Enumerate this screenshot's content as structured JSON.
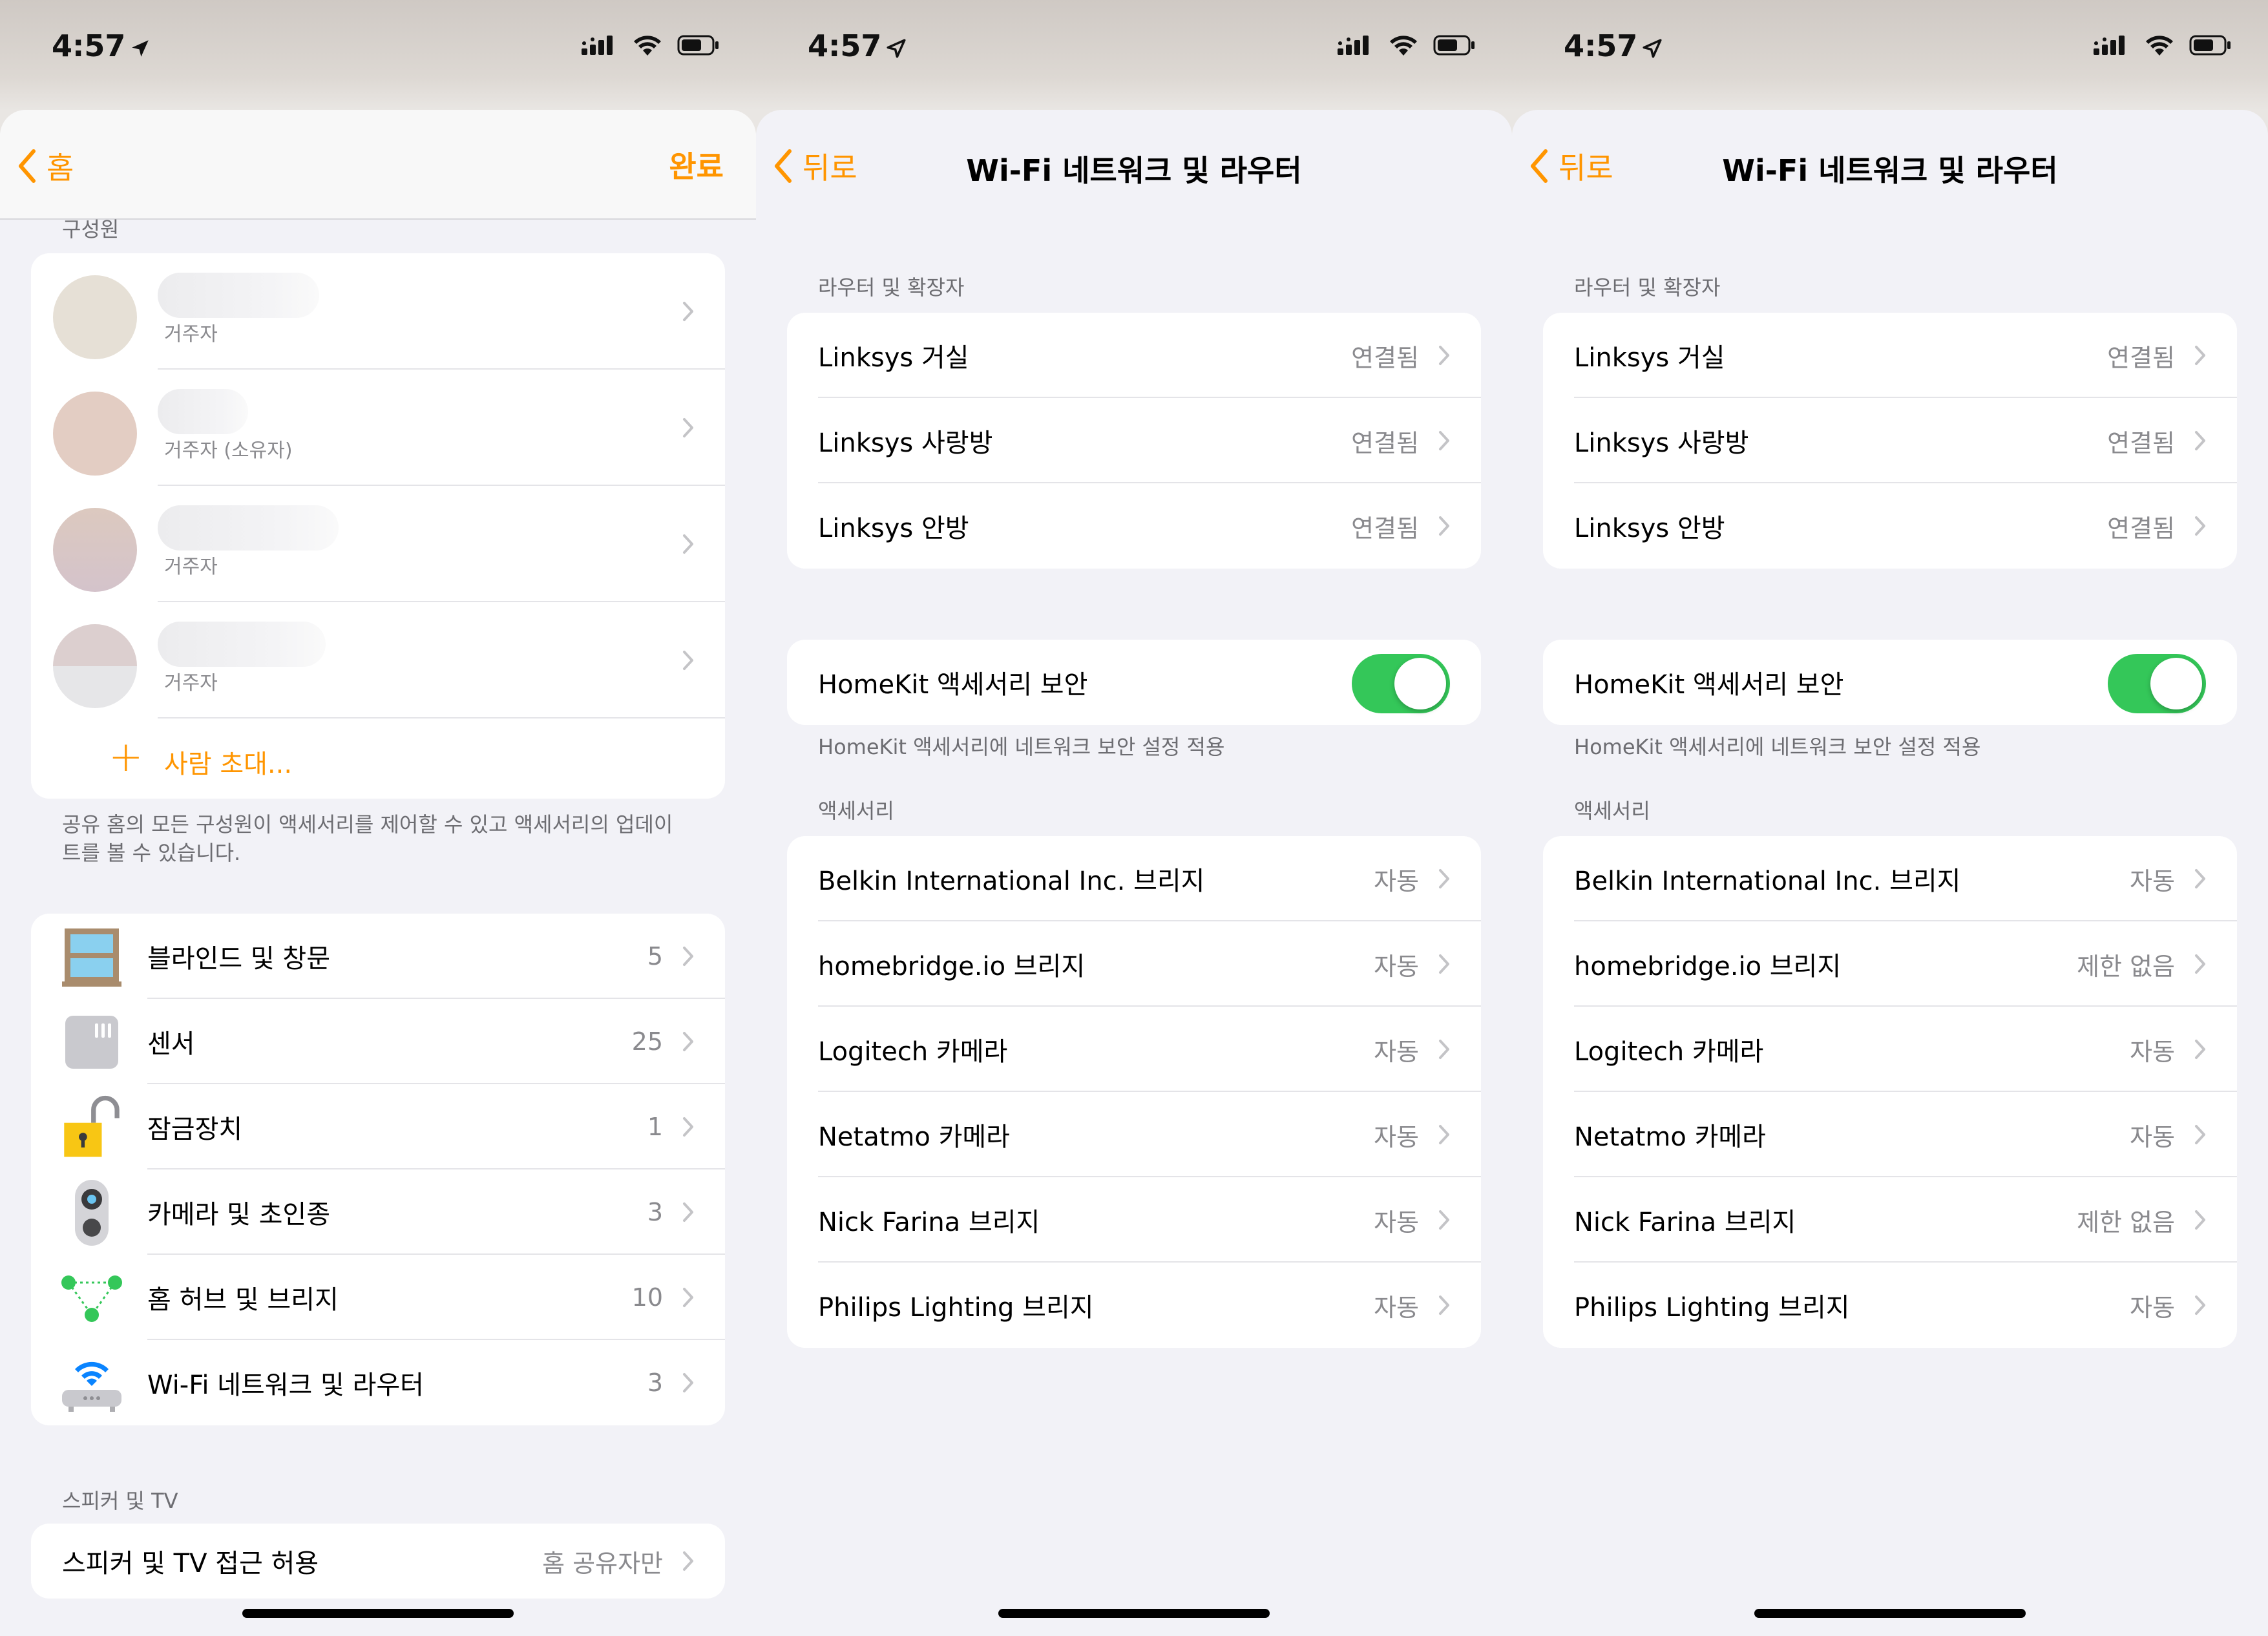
{
  "status": {
    "time": "4:57"
  },
  "colors": {
    "accent": "#ff9500",
    "toggle_on": "#34c759",
    "secondary_text": "#8a8a8e"
  },
  "screen1": {
    "back_label": "홈",
    "done_label": "완료",
    "members_header": "구성원",
    "members": [
      {
        "role": "거주자"
      },
      {
        "role": "거주자 (소유자)"
      },
      {
        "role": "거주자"
      },
      {
        "role": "거주자"
      }
    ],
    "invite_label": "사람 초대...",
    "footer": "공유 홈의 모든 구성원이 액세서리를 제어할 수 있고 액세서리의 업데이트를 볼 수 있습니다.",
    "categories": [
      {
        "label": "블라인드 및 창문",
        "count": "5",
        "icon": "window-icon"
      },
      {
        "label": "센서",
        "count": "25",
        "icon": "sensor-icon"
      },
      {
        "label": "잠금장치",
        "count": "1",
        "icon": "lock-icon"
      },
      {
        "label": "카메라 및 초인종",
        "count": "3",
        "icon": "camera-icon"
      },
      {
        "label": "홈 허브 및 브리지",
        "count": "10",
        "icon": "hub-icon"
      },
      {
        "label": "Wi-Fi 네트워크 및 라우터",
        "count": "3",
        "icon": "wifi-router-icon"
      }
    ],
    "speakers_header": "스피커 및 TV",
    "speakers_row": {
      "label": "스피커 및 TV 접근 허용",
      "value": "홈 공유자만"
    }
  },
  "screen2": {
    "back_label": "뒤로",
    "title": "Wi-Fi 네트워크 및 라우터",
    "routers_header": "라우터 및 확장자",
    "routers": [
      {
        "label": "Linksys 거실",
        "value": "연결됨"
      },
      {
        "label": "Linksys 사랑방",
        "value": "연결됨"
      },
      {
        "label": "Linksys 안방",
        "value": "연결됨"
      }
    ],
    "security_label": "HomeKit 액세서리 보안",
    "security_footer": "HomeKit 액세서리에 네트워크 보안 설정 적용",
    "accessories_header": "액세서리",
    "accessories": [
      {
        "label": "Belkin International Inc. 브리지",
        "value": "자동"
      },
      {
        "label": "homebridge.io 브리지",
        "value": "자동"
      },
      {
        "label": "Logitech 카메라",
        "value": "자동"
      },
      {
        "label": "Netatmo 카메라",
        "value": "자동"
      },
      {
        "label": "Nick Farina 브리지",
        "value": "자동"
      },
      {
        "label": "Philips Lighting 브리지",
        "value": "자동"
      }
    ]
  },
  "screen3": {
    "back_label": "뒤로",
    "title": "Wi-Fi 네트워크 및 라우터",
    "routers_header": "라우터 및 확장자",
    "routers": [
      {
        "label": "Linksys 거실",
        "value": "연결됨"
      },
      {
        "label": "Linksys 사랑방",
        "value": "연결됨"
      },
      {
        "label": "Linksys 안방",
        "value": "연결됨"
      }
    ],
    "security_label": "HomeKit 액세서리 보안",
    "security_footer": "HomeKit 액세서리에 네트워크 보안 설정 적용",
    "accessories_header": "액세서리",
    "accessories": [
      {
        "label": "Belkin International Inc. 브리지",
        "value": "자동"
      },
      {
        "label": "homebridge.io 브리지",
        "value": "제한 없음"
      },
      {
        "label": "Logitech 카메라",
        "value": "자동"
      },
      {
        "label": "Netatmo 카메라",
        "value": "자동"
      },
      {
        "label": "Nick Farina 브리지",
        "value": "제한 없음"
      },
      {
        "label": "Philips Lighting 브리지",
        "value": "자동"
      }
    ]
  }
}
